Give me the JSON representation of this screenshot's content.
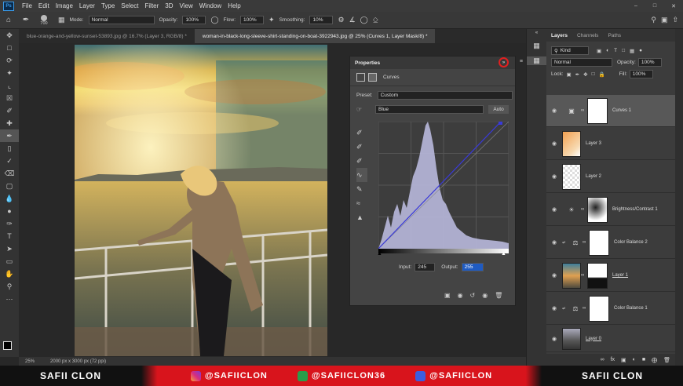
{
  "menu": [
    "File",
    "Edit",
    "Image",
    "Layer",
    "Type",
    "Select",
    "Filter",
    "3D",
    "View",
    "Window",
    "Help"
  ],
  "options": {
    "brush_size": "700",
    "mode_label": "Mode:",
    "mode_value": "Normal",
    "opacity_label": "Opacity:",
    "opacity_value": "100%",
    "flow_label": "Flow:",
    "flow_value": "100%",
    "smoothing_label": "Smoothing:",
    "smoothing_value": "10%"
  },
  "tabs": [
    {
      "label": "blue-orange-and-yellow-sunset-53893.jpg @ 16.7% (Layer 3, RGB/8) *"
    },
    {
      "label": "woman-in-black-long-sleeve-shirt-standing-on-boat-3922943.jpg @ 25% (Curves 1, Layer Mask/8) *"
    }
  ],
  "properties": {
    "title": "Properties",
    "adjustment": "Curves",
    "preset_label": "Preset:",
    "preset_value": "Custom",
    "channel": "Blue",
    "auto": "Auto",
    "input_label": "Input:",
    "input_value": "245",
    "output_label": "Output:",
    "output_value": "255"
  },
  "status": {
    "zoom": "25%",
    "size": "2000 px x 3000 px (72 ppi)"
  },
  "layers_panel": {
    "tabs": [
      "Layers",
      "Channels",
      "Paths"
    ],
    "kind": "Kind",
    "blend": "Normal",
    "opacity_label": "Opacity:",
    "opacity_value": "100%",
    "lock_label": "Lock:",
    "fill_label": "Fill:",
    "fill_value": "100%",
    "layers": [
      {
        "name": "Curves 1"
      },
      {
        "name": "Layer 3"
      },
      {
        "name": "Layer 2"
      },
      {
        "name": "Brightness/Contrast 1"
      },
      {
        "name": "Color Balance 2"
      },
      {
        "name": "Layer 1"
      },
      {
        "name": "Color Balance 1"
      },
      {
        "name": "Layer 0"
      }
    ]
  },
  "footer": {
    "left": "SAFII CLON",
    "instagram": "@SAFIICLON",
    "twitter": "@SAFIICLON36",
    "facebook": "@SAFIICLON",
    "right": "SAFII CLON"
  },
  "colors": {
    "accent": "#e02020",
    "panel": "#444444",
    "selected": "#585858"
  }
}
